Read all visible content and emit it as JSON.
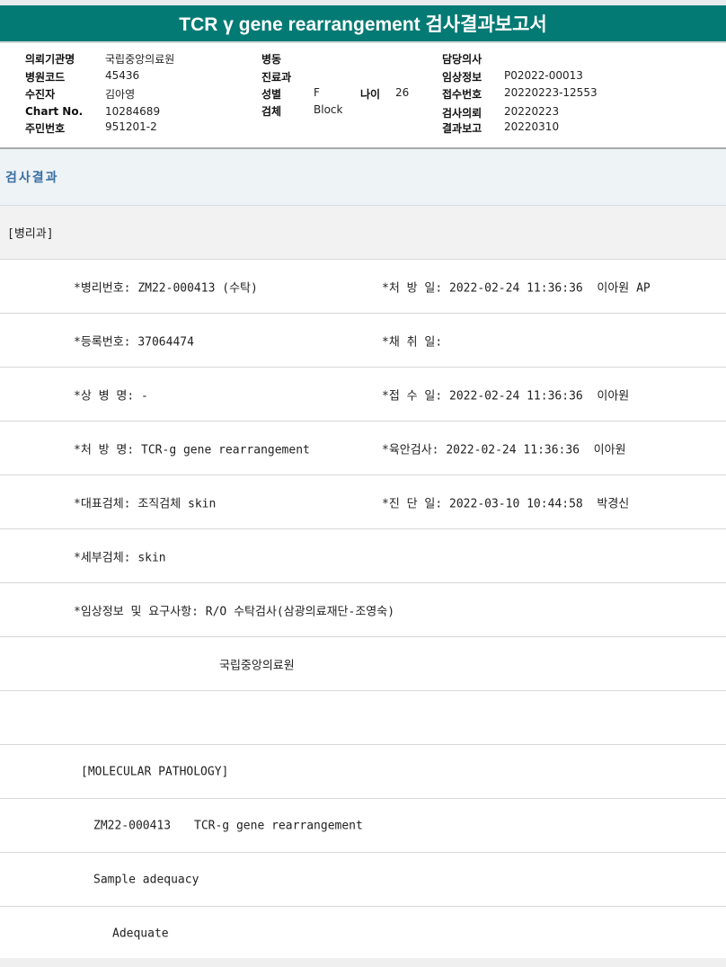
{
  "report": {
    "title": "TCR γ gene rearrangement 검사결과보고서"
  },
  "header_info": {
    "col1": [
      {
        "label": "의뢰기관명",
        "value": "국립중앙의료원"
      },
      {
        "label": "병원코드",
        "value": "45436"
      },
      {
        "label": "수진자",
        "value": "김아영"
      },
      {
        "label": "Chart No.",
        "value": "10284689"
      },
      {
        "label": "주민번호",
        "value": "951201-2"
      }
    ],
    "col2": [
      {
        "label": "병동",
        "value": ""
      },
      {
        "label": "진료과",
        "value": ""
      },
      {
        "label": "성별",
        "value": "F"
      },
      {
        "label": "검체",
        "value": "Block"
      }
    ],
    "age": {
      "label": "나이",
      "value": "26"
    },
    "col3": [
      {
        "label": "담당의사",
        "value": ""
      },
      {
        "label": "임상정보",
        "value": "P02022-00013"
      },
      {
        "label": "접수번호",
        "value": "20220223-12553"
      },
      {
        "label": "검사의뢰",
        "value": "20220223"
      },
      {
        "label": "결과보고",
        "value": "20220310"
      }
    ]
  },
  "section": {
    "title": "검사결과",
    "department": "[병리과]"
  },
  "results": {
    "pathology_no": "*병리번호: ZM22-000413 (수탁)",
    "order_date": "*처 방 일: 2022-02-24 11:36:36  이아원 AP",
    "registration_no": "*등록번호: 37064474",
    "collection_date": "*채 취 일:",
    "diagnosis_name": "*상 병 명: -",
    "receipt_date": "*접 수 일: 2022-02-24 11:36:36  이아원",
    "order_name": "*처 방 명: TCR-g gene rearrangement",
    "gross_exam": "*육안검사: 2022-02-24 11:36:36  이아원",
    "main_specimen": "*대표검체: 조직검체 skin",
    "diagnosis_date": "*진 단 일: 2022-03-10 10:44:58  박경신",
    "sub_specimen": "*세부검체: skin",
    "clinical_info": "*임상정보 및 요구사항: R/O 수탁검사(삼광의료재단-조영숙)",
    "institution": "국립중앙의료원",
    "molecular_header": "[MOLECULAR PATHOLOGY]",
    "case_no": "ZM22-000413",
    "test_name": "TCR-g gene rearrangement",
    "adequacy_label": "Sample adequacy",
    "adequacy_value": "Adequate"
  }
}
